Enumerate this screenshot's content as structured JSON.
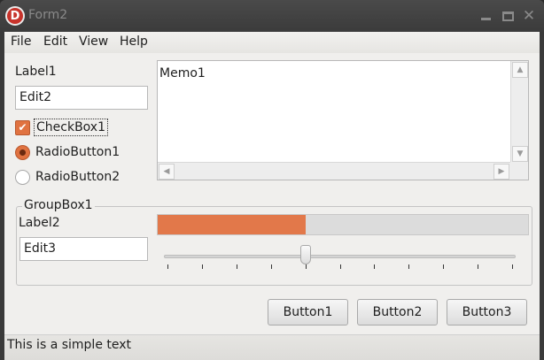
{
  "window": {
    "title": "Form2",
    "icon_letter": "D"
  },
  "menu": {
    "items": [
      "File",
      "Edit",
      "View",
      "Help"
    ]
  },
  "controls": {
    "label1": "Label1",
    "edit2": "Edit2",
    "checkbox1": {
      "label": "CheckBox1",
      "checked": true
    },
    "radio1": {
      "label": "RadioButton1",
      "selected": true
    },
    "radio2": {
      "label": "RadioButton2",
      "selected": false
    },
    "memo1": "Memo1"
  },
  "groupbox": {
    "title": "GroupBox1",
    "label2": "Label2",
    "edit3": "Edit3",
    "progress_fraction": 0.4,
    "trackbar": {
      "position": 4,
      "max": 10
    }
  },
  "buttons": [
    "Button1",
    "Button2",
    "Button3"
  ],
  "status": {
    "text": "This is a simple text"
  },
  "colors": {
    "accent": "#e2784a",
    "background": "#f0efed",
    "titlebar": "#3b3b3b"
  }
}
